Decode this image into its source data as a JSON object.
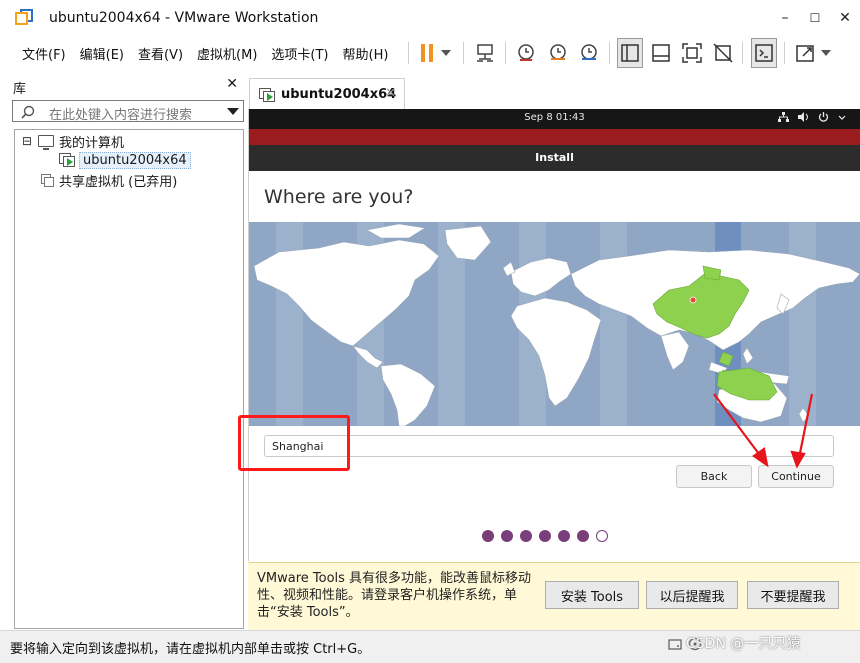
{
  "window": {
    "title": "ubuntu2004x64 - VMware Workstation",
    "minimize": "–",
    "maximize": "☐",
    "close": "✕"
  },
  "menu": [
    "文件(F)",
    "编辑(E)",
    "查看(V)",
    "虚拟机(M)",
    "选项卡(T)",
    "帮助(H)"
  ],
  "library": {
    "title": "库",
    "close": "✕",
    "search_placeholder": "在此处键入内容进行搜索",
    "tree": {
      "root_expander": "⊟",
      "root": "我的计算机",
      "vm": "ubuntu2004x64",
      "shared": "共享虚拟机 (已弃用)"
    }
  },
  "tab": {
    "label": "ubuntu2004x64",
    "close": "✕"
  },
  "guest": {
    "clock": "Sep 8  01:43",
    "sys_icons": [
      "network-icon",
      "volume-icon",
      "power-icon"
    ],
    "window_title": "Install",
    "heading": "Where are you?",
    "location_value": "Shanghai",
    "back_label": "Back",
    "continue_label": "Continue",
    "progress": {
      "total": 7,
      "current": 7
    },
    "colors": {
      "map_ocean": "#8fa6c4",
      "land": "#ffffff",
      "selected_zone": "#8ed14f",
      "accent": "#7a3e7a"
    }
  },
  "tools_bar": {
    "message": "VMware Tools 具有很多功能，能改善鼠标移动性、视频和性能。请登录客户机操作系统，单击“安装 Tools”。",
    "install_label": "安装 Tools",
    "remind_label": "以后提醒我",
    "never_label": "不要提醒我"
  },
  "status": {
    "text": "要将输入定向到该虚拟机，请在虚拟机内部单击或按 Ctrl+G。",
    "watermark": "CSDN @一只只猿"
  }
}
